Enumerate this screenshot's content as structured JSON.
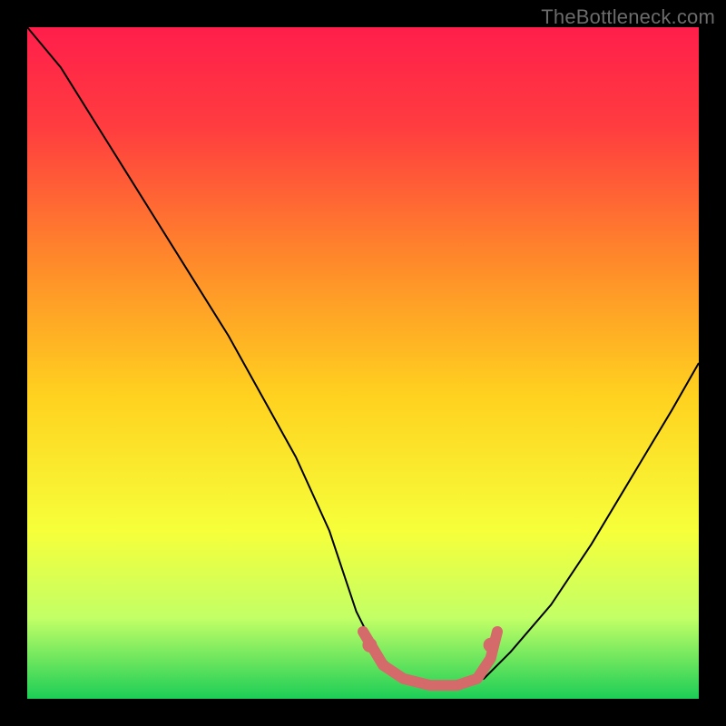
{
  "watermark": "TheBottleneck.com",
  "chart_data": {
    "type": "line",
    "title": "",
    "xlabel": "",
    "ylabel": "",
    "xlim": [
      0,
      100
    ],
    "ylim": [
      0,
      100
    ],
    "background_gradient": {
      "stops": [
        {
          "offset": 0,
          "color": "#ff1e4b"
        },
        {
          "offset": 15,
          "color": "#ff3d3f"
        },
        {
          "offset": 35,
          "color": "#ff8a2a"
        },
        {
          "offset": 55,
          "color": "#ffd21f"
        },
        {
          "offset": 75,
          "color": "#f6ff3a"
        },
        {
          "offset": 88,
          "color": "#c2ff66"
        },
        {
          "offset": 100,
          "color": "#1cce57"
        }
      ]
    },
    "series": [
      {
        "name": "bottleneck-curve",
        "color": "#000000",
        "x": [
          0,
          5,
          10,
          15,
          20,
          25,
          30,
          35,
          40,
          45,
          49,
          52,
          56,
          60,
          64,
          68,
          72,
          78,
          84,
          90,
          96,
          100
        ],
        "y": [
          100,
          94,
          86,
          78,
          70,
          62,
          54,
          45,
          36,
          25,
          13,
          7,
          3,
          2,
          2,
          3,
          7,
          14,
          23,
          33,
          43,
          50
        ]
      }
    ],
    "highlight_band": {
      "name": "optimal-range",
      "color": "#d46a6a",
      "points": [
        {
          "x": 50,
          "y": 10
        },
        {
          "x": 53,
          "y": 5
        },
        {
          "x": 56,
          "y": 3
        },
        {
          "x": 60,
          "y": 2
        },
        {
          "x": 64,
          "y": 2
        },
        {
          "x": 67,
          "y": 3
        },
        {
          "x": 69,
          "y": 6
        },
        {
          "x": 70,
          "y": 10
        }
      ],
      "dots": [
        {
          "x": 51,
          "y": 8
        },
        {
          "x": 69,
          "y": 8
        }
      ]
    }
  }
}
